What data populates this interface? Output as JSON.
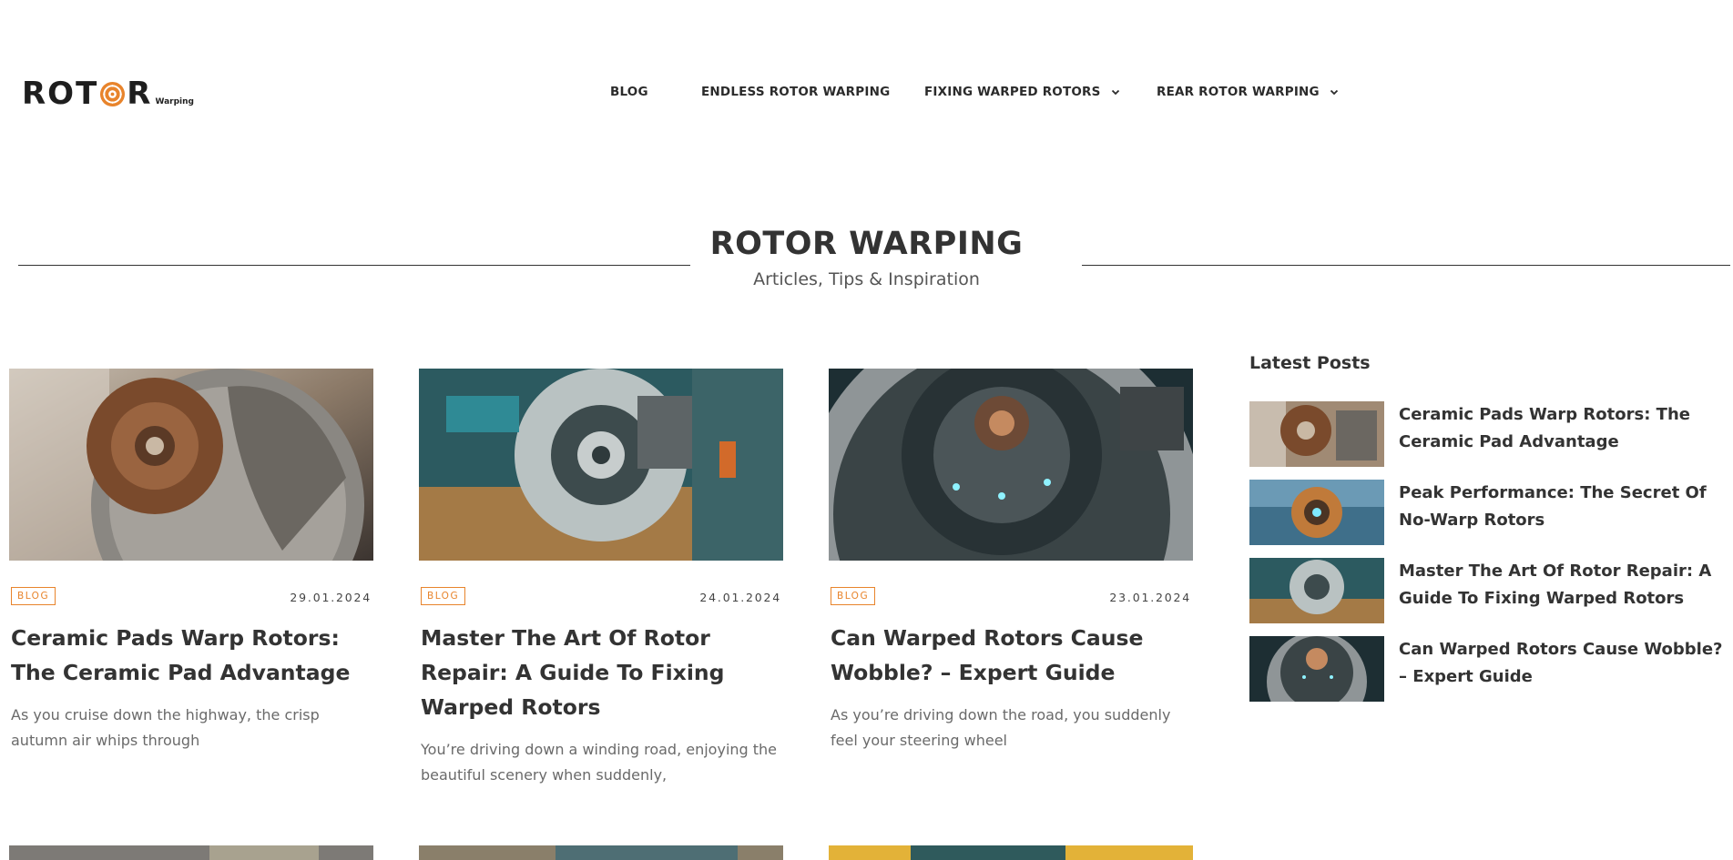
{
  "logo": {
    "word": "ROTOR",
    "word_left": "ROT",
    "word_right": "R",
    "sub": "Warping"
  },
  "nav": {
    "items": [
      {
        "label": "BLOG",
        "dropdown": false
      },
      {
        "label": "ENDLESS ROTOR WARPING",
        "dropdown": false
      },
      {
        "label": "FIXING WARPED ROTORS",
        "dropdown": true
      },
      {
        "label": "REAR ROTOR WARPING",
        "dropdown": true
      }
    ]
  },
  "hero": {
    "title": "ROTOR WARPING",
    "subtitle": "Articles, Tips & Inspiration"
  },
  "posts": [
    {
      "tag": "BLOG",
      "date": "29.01.2024",
      "title": "Ceramic Pads Warp Rotors: The Ceramic Pad Advantage",
      "excerpt": "As you cruise down the highway, the crisp autumn air whips through"
    },
    {
      "tag": "BLOG",
      "date": "24.01.2024",
      "title": "Master The Art Of Rotor Repair: A Guide To Fixing Warped Rotors",
      "excerpt": "You’re driving down a winding road, enjoying the beautiful scenery when suddenly,"
    },
    {
      "tag": "BLOG",
      "date": "23.01.2024",
      "title": "Can Warped Rotors Cause Wobble? – Expert Guide",
      "excerpt": "As you’re driving down the road, you suddenly feel your steering wheel"
    }
  ],
  "sidebar": {
    "title": "Latest Posts",
    "items": [
      {
        "label": "Ceramic Pads Warp Rotors: The Ceramic Pad Advantage"
      },
      {
        "label": "Peak Performance: The Secret Of No-Warp Rotors"
      },
      {
        "label": "Master The Art Of Rotor Repair: A Guide To Fixing Warped Rotors"
      },
      {
        "label": "Can Warped Rotors Cause Wobble? – Expert Guide"
      }
    ]
  },
  "colors": {
    "accent": "#e8842c",
    "text": "#333333",
    "muted": "#6a6a6a"
  }
}
